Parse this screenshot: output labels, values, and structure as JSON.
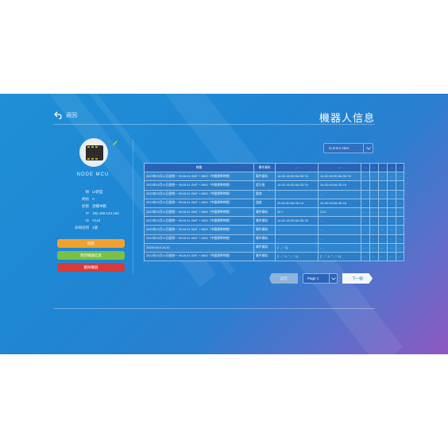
{
  "header": {
    "back_label": "返回",
    "title": "機器人信息"
  },
  "robot": {
    "name": "NODE MCU"
  },
  "info": [
    {
      "k": "類",
      "v": "UI新型"
    },
    {
      "k": "網絡",
      "v": "A"
    },
    {
      "k": "狀態",
      "v": "流暢中斷"
    },
    {
      "k": "IP",
      "v": "192.168.123.150"
    },
    {
      "k": "ID",
      "v": "V1x4"
    },
    {
      "k": "詳細說明",
      "v": "1號"
    }
  ],
  "actions": {
    "orange": "刷新",
    "green": "更新機器信息",
    "red": "刪除機器"
  },
  "select": {
    "label": "Current Alert"
  },
  "table": {
    "headers": [
      "時間",
      "事件資料",
      "…",
      "…",
      "…",
      "…",
      "…",
      "…",
      "…"
    ],
    "rows": [
      [
        "2023年03月10日星期一 09:26:31 GMT + 0800（中國標準時間）",
        "事件資料",
        "1A:3C:40:0D:5A:3D:7A",
        "1A:3C:40:0D:5A:3D:7A",
        "…",
        "…",
        "…",
        "…",
        "…"
      ],
      [
        "2023年03月10日星期一 09:26:31 GMT + 0800（中國標準時間）",
        "藍牙連",
        "1A:3C:40:0D:5A:3D:7A",
        "2A:3D:40:5A:3D:7A",
        "…",
        "…",
        "…",
        "…",
        "…"
      ],
      [
        "2023年03月10日星期一 09:26:31 GMT + 0800（中國標準時間）",
        "重啓",
        "…",
        "…",
        "…",
        "…",
        "…",
        "…",
        "…"
      ],
      [
        "2023年03月10日星期一 09:26:31 GMT + 0800（中國標準時間）",
        "溫度",
        "20:3A:3D:5A:3D:7A",
        "2A:3D:40:5A:3D:7A",
        "…",
        "…",
        "…",
        "…",
        "…"
      ],
      [
        "2023年03月10日星期一 09:26:31 GMT + 0800（中國標準時間）",
        "事件資料",
        "22.7",
        "21.0",
        "…",
        "…",
        "…",
        "…",
        "…"
      ],
      [
        "2023年03月10日星期一 09:26:31 GMT + 0800（中國標準時間）",
        "事件資料",
        "1A:3C:40:0D:5A:3D:7A",
        "…",
        "…",
        "…",
        "…",
        "…",
        "…"
      ],
      [
        "2023年03月10日星期一 09:26:31 GMT + 0800（中國標準時間）",
        "事件資料",
        "…",
        "…",
        "…",
        "…",
        "…",
        "…",
        "…"
      ],
      [
        "2023年03月10日星期一 09:26:31 GMT + 0800（中國標準時間）",
        "事件資料",
        "…",
        "…",
        "…",
        "…",
        "…",
        "…",
        "…"
      ],
      [
        "2023/03/10 24:30",
        "事件資料",
        "{\"…\": 1}",
        "…",
        "…",
        "…",
        "…",
        "…",
        "…"
      ],
      [
        "2023年03月10日星期一 09:26:31 GMT + 0800（中國標準時間）",
        "事件資料",
        "{\"…\": 1, \"…\": 1}",
        "{\"…\": 1, \"…\": 1}",
        "…",
        "…",
        "…",
        "…",
        "…"
      ]
    ]
  },
  "pager": {
    "prev": "返回",
    "page": "Page 1",
    "next": "下一個"
  },
  "colors": {
    "accent_orange": "#f2a12e",
    "accent_green": "#79c143",
    "accent_red": "#d63a3a",
    "bg_blue": "#1f8fd6",
    "bg_purple": "#8d57c0"
  }
}
